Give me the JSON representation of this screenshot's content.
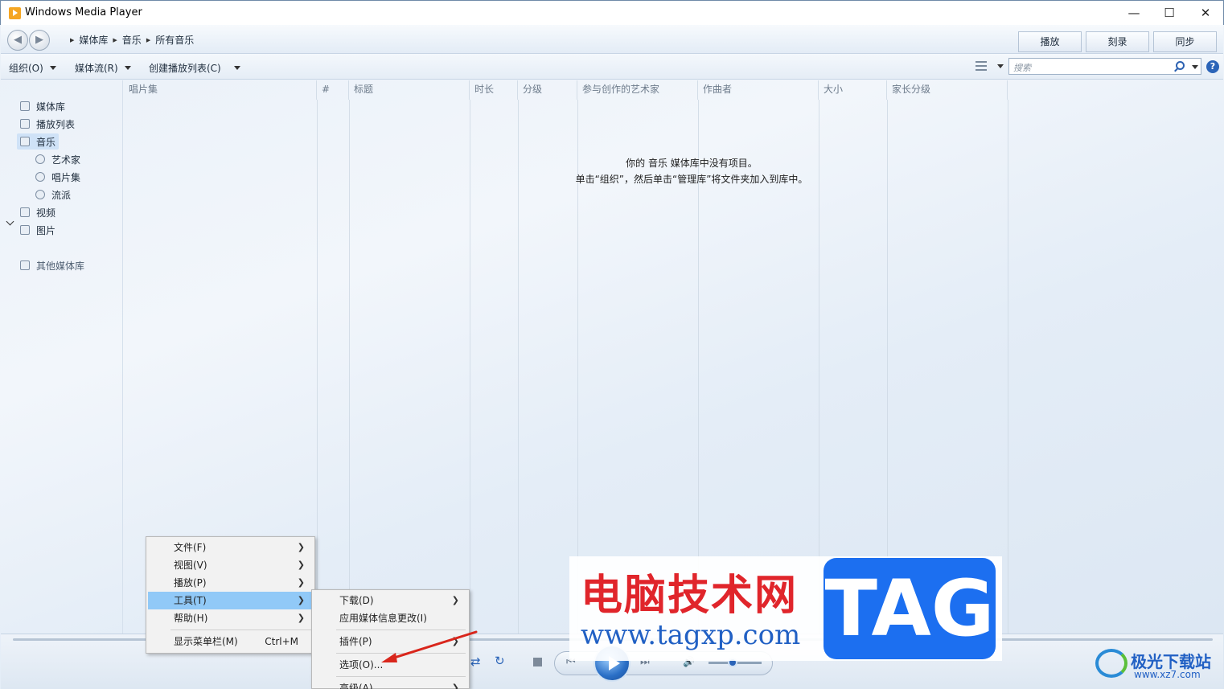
{
  "window": {
    "title": "Windows Media Player",
    "min": "—",
    "max": "☐",
    "close": "✕"
  },
  "nav": {
    "back": "◀",
    "forward": "▶",
    "breadcrumb": [
      "媒体库",
      "音乐",
      "所有音乐"
    ],
    "tabs": [
      "播放",
      "刻录",
      "同步"
    ]
  },
  "toolbar": {
    "organize": "组织(O)",
    "stream": "媒体流(R)",
    "create_playlist": "创建播放列表(C)",
    "search_placeholder": "搜索",
    "help": "?"
  },
  "sidebar": {
    "library": "媒体库",
    "playlists": "播放列表",
    "music": "音乐",
    "artist": "艺术家",
    "album": "唱片集",
    "genre": "流派",
    "video": "视频",
    "pictures": "图片",
    "other": "其他媒体库"
  },
  "columns": [
    "唱片集",
    "#",
    "标题",
    "时长",
    "分级",
    "参与创作的艺术家",
    "作曲者",
    "大小",
    "家长分级"
  ],
  "empty_message": {
    "line1": "你的 音乐 媒体库中没有项目。",
    "line2": "单击“组织”，然后单击“管理库”将文件夹加入到库中。"
  },
  "context_menu": {
    "items": [
      "文件(F)",
      "视图(V)",
      "播放(P)",
      "工具(T)",
      "帮助(H)"
    ],
    "show_menubar": "显示菜单栏(M)",
    "show_menubar_shortcut": "Ctrl+M",
    "highlighted": "工具(T)"
  },
  "tools_submenu": {
    "download": "下载(D)",
    "apply_media_info": "应用媒体信息更改(I)",
    "plugins": "插件(P)",
    "options": "选项(O)...",
    "advanced": "高级(A)"
  },
  "player": {
    "shuffle": "⇄",
    "repeat": "↻",
    "prev": "⏮",
    "next": "⏭",
    "volume_icon": "🔊",
    "volume_level": 0.45
  },
  "watermark": {
    "cn": "电脑技术网",
    "url": "www.tagxp.com",
    "tag": "TAG"
  },
  "watermark2": {
    "name": "极光下载站",
    "url": "www.xz7.com"
  },
  "colors": {
    "accent": "#2b64b8",
    "menu_highlight": "#91c9f7",
    "sidebar_selected": "#cfe2f7",
    "watermark_red": "#e0252b",
    "watermark_blue": "#1c6ff0"
  }
}
